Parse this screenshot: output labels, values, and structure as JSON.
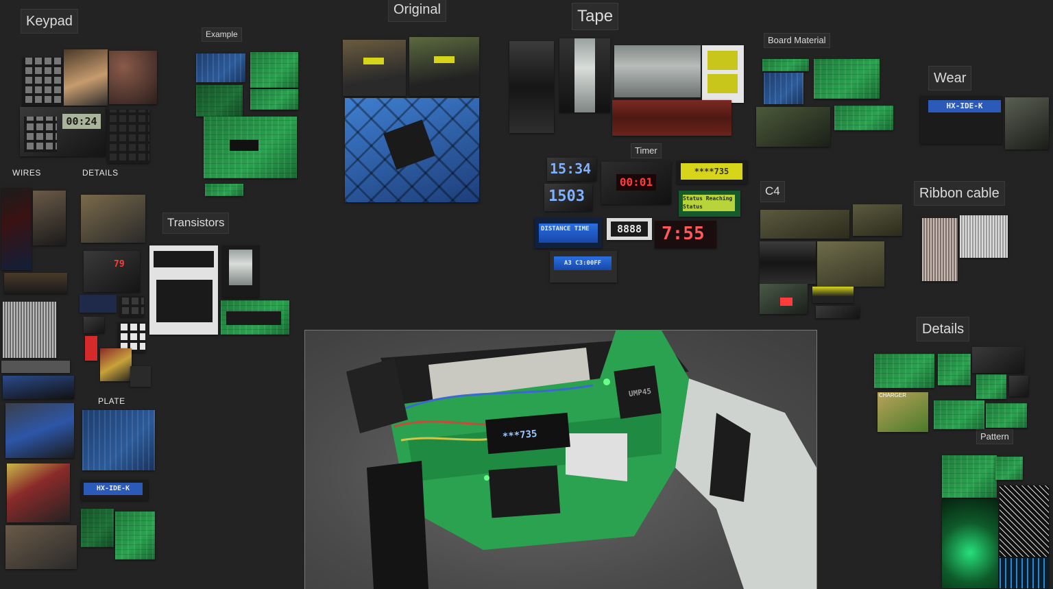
{
  "labels": {
    "keypad": "Keypad",
    "example": "Example",
    "original": "Original",
    "tape": "Tape",
    "board_material": "Board Material",
    "wear": "Wear",
    "timer": "Timer",
    "c4": "C4",
    "ribbon_cable": "Ribbon cable",
    "transistors": "Transistors",
    "wires": "WIRES",
    "details_small": "DETAILS",
    "plate": "PLATE",
    "details": "Details",
    "pattern": "Pattern"
  },
  "displays": {
    "keypad_clock": "00:24",
    "timer_blue_digits_1": "15:34",
    "timer_blue_digits_2": "1503",
    "timer_red": "00:01",
    "timer_yellow": "****735",
    "timer_green_lcd": "Status Reaching Status",
    "timer_blue_lcd": "DISTANCE TIME",
    "timer_white": "8888",
    "timer_red_big": "7:55",
    "timer_small_blue": "A3 C3:00FF",
    "wear_board": "HX-IDE-K",
    "plate_board": "HX-IDE-K",
    "weapon_lcd": "***735",
    "weapon_chip": "UMP45",
    "details_charger": "CHARGER"
  },
  "colors": {
    "background": "#232323",
    "pcb_green": "#2aa24f",
    "lcd_yellow": "#d7d51a",
    "lcd_blue": "#2a6fe0",
    "led_red": "#ff3b3b"
  }
}
